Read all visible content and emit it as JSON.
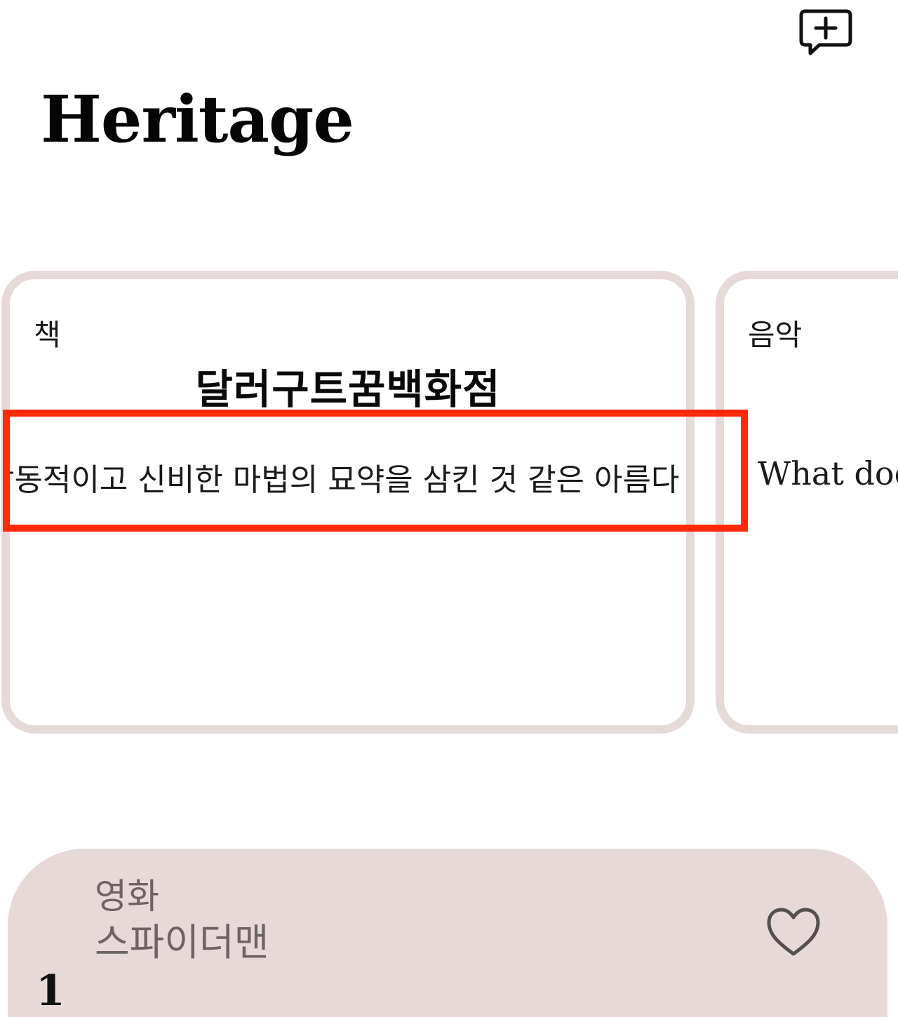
{
  "header": {
    "title": "Heritage",
    "add_button_icon": "chat-bubble-plus-icon"
  },
  "cards": [
    {
      "category": "책",
      "title": "달러구트꿈백화점",
      "snippet": "감동적이고 신비한 마법의 묘약을 삼킨 것 같은 아름다"
    },
    {
      "category": "음악",
      "title": "",
      "snippet": "What doe"
    }
  ],
  "bottom_card": {
    "category": "영화",
    "title": "스파이더맨",
    "rank": "1",
    "like_icon": "heart-outline-icon"
  },
  "colors": {
    "card_border": "#e6dad9",
    "bottom_card_bg": "#e6d9d8",
    "highlight": "#ff2a0a",
    "muted_text": "#6b6464"
  }
}
